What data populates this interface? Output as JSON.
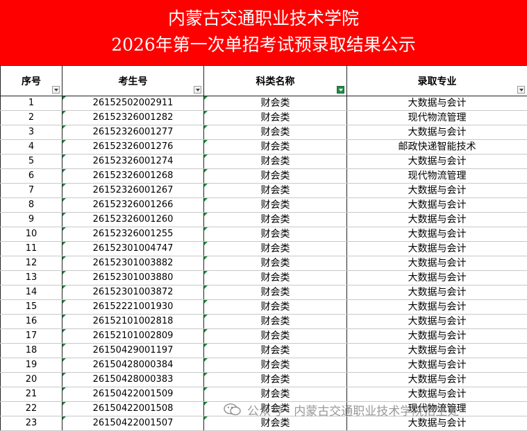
{
  "header": {
    "line1": "内蒙古交通职业技术学院",
    "line2": "2026年第一次单招考试预录取结果公示",
    "bg_color": "#ff0000"
  },
  "columns": [
    "序号",
    "考生号",
    "科类名称",
    "录取专业"
  ],
  "rows": [
    [
      "1",
      "26152502002911",
      "财会类",
      "大数据与会计"
    ],
    [
      "2",
      "26152326001282",
      "财会类",
      "现代物流管理"
    ],
    [
      "3",
      "26152326001277",
      "财会类",
      "大数据与会计"
    ],
    [
      "4",
      "26152326001276",
      "财会类",
      "邮政快递智能技术"
    ],
    [
      "5",
      "26152326001274",
      "财会类",
      "大数据与会计"
    ],
    [
      "6",
      "26152326001268",
      "财会类",
      "现代物流管理"
    ],
    [
      "7",
      "26152326001267",
      "财会类",
      "大数据与会计"
    ],
    [
      "8",
      "26152326001266",
      "财会类",
      "大数据与会计"
    ],
    [
      "9",
      "26152326001260",
      "财会类",
      "大数据与会计"
    ],
    [
      "10",
      "26152326001255",
      "财会类",
      "大数据与会计"
    ],
    [
      "11",
      "26152301004747",
      "财会类",
      "大数据与会计"
    ],
    [
      "12",
      "26152301003882",
      "财会类",
      "大数据与会计"
    ],
    [
      "13",
      "26152301003880",
      "财会类",
      "大数据与会计"
    ],
    [
      "14",
      "26152301003872",
      "财会类",
      "大数据与会计"
    ],
    [
      "15",
      "26152221001930",
      "财会类",
      "大数据与会计"
    ],
    [
      "16",
      "26152101002818",
      "财会类",
      "大数据与会计"
    ],
    [
      "17",
      "26152101002809",
      "财会类",
      "大数据与会计"
    ],
    [
      "18",
      "26150429001197",
      "财会类",
      "大数据与会计"
    ],
    [
      "19",
      "26150428000384",
      "财会类",
      "大数据与会计"
    ],
    [
      "20",
      "26150428000383",
      "财会类",
      "大数据与会计"
    ],
    [
      "21",
      "26150422001509",
      "财会类",
      "大数据与会计"
    ],
    [
      "22",
      "26150422001508",
      "财会类",
      "现代物流管理"
    ],
    [
      "23",
      "26150422001507",
      "财会类",
      "大数据与会计"
    ]
  ],
  "watermark": {
    "text": "公众号 · 内蒙古交通职业技术学院招生处",
    "icon": "wechat-icon"
  }
}
